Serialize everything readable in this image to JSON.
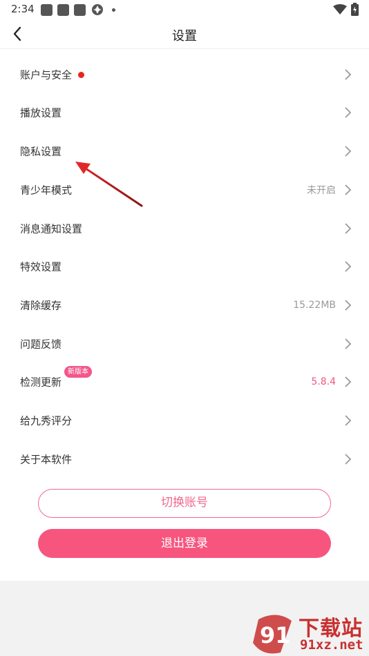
{
  "status_bar": {
    "time": "2:34"
  },
  "header": {
    "title": "设置"
  },
  "settings": [
    {
      "label": "账户与安全",
      "has_red_dot": true
    },
    {
      "label": "播放设置"
    },
    {
      "label": "隐私设置"
    },
    {
      "label": "青少年模式",
      "value": "未开启"
    },
    {
      "label": "消息通知设置"
    },
    {
      "label": "特效设置"
    },
    {
      "label": "清除缓存",
      "value": "15.22MB"
    },
    {
      "label": "问题反馈"
    },
    {
      "label": "检测更新",
      "badge": "新版本",
      "value": "5.8.4",
      "value_color": "#ef5781"
    },
    {
      "label": "给九秀评分"
    },
    {
      "label": "关于本软件"
    }
  ],
  "buttons": {
    "switch_account": "切换账号",
    "logout": "退出登录"
  },
  "watermark": {
    "line1": "下载站",
    "line2": "91xz.net",
    "logo_text": "91"
  },
  "colors": {
    "accent": "#f7557e",
    "red_dot": "#e8251b",
    "arrow": "#d42a2a"
  }
}
